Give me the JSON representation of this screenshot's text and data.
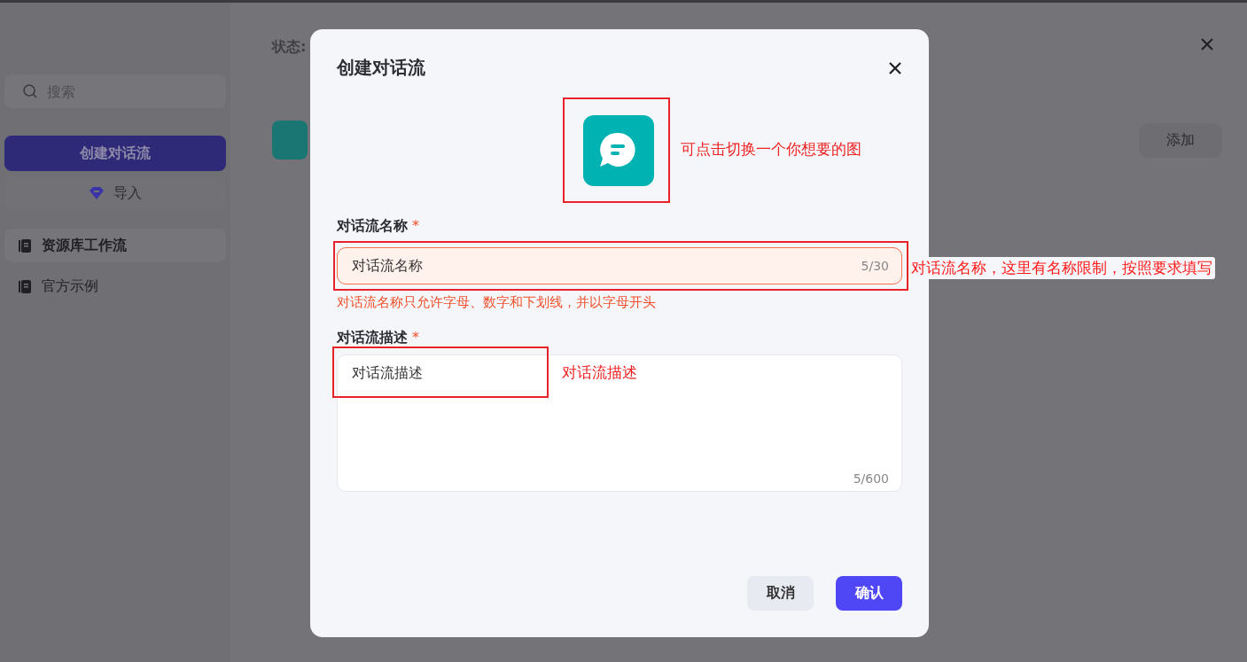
{
  "sidebar": {
    "search": {
      "placeholder": "搜索"
    },
    "create_button": "创建对话流",
    "import_button": "导入",
    "items": [
      {
        "label": "资源库工作流",
        "selected": true
      },
      {
        "label": "官方示例",
        "selected": false
      }
    ]
  },
  "main": {
    "status_label": "状态:",
    "add_button": "添加"
  },
  "dialog": {
    "title": "创建对话流",
    "icon_annotation": "可点击切换一个你想要的图",
    "name_field": {
      "label": "对话流名称",
      "required_mark": "*",
      "value": "对话流名称",
      "counter": "5/30",
      "invalid": true,
      "error": "对话流名称只允许字母、数字和下划线，并以字母开头",
      "annotation": "对话流名称，这里有名称限制，按照要求填写"
    },
    "description_field": {
      "label": "对话流描述",
      "required_mark": "*",
      "value": "对话流描述",
      "counter": "5/600",
      "annotation": "对话流描述"
    },
    "buttons": [
      {
        "label": "取消",
        "kind": "secondary"
      },
      {
        "label": "确认",
        "kind": "primary"
      }
    ]
  }
}
